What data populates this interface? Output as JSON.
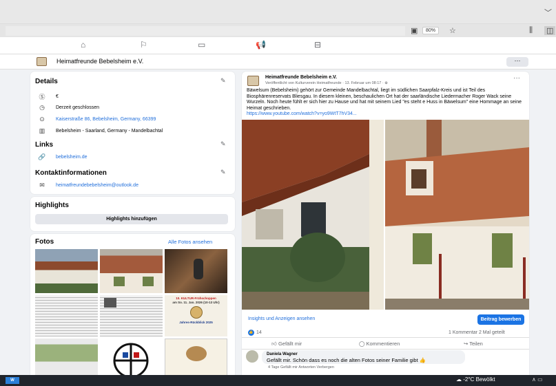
{
  "browser": {
    "zoom": "80%",
    "icons": [
      "chevron-down-icon",
      "screen-icon",
      "star-icon",
      "library-icon",
      "sidebar-icon"
    ]
  },
  "fb_nav": {
    "icons": [
      "home-icon",
      "flag-icon",
      "video-icon",
      "megaphone-icon",
      "gaming-icon"
    ]
  },
  "page": {
    "name": "Heimatfreunde Bebelsheim e.V.",
    "more": "···"
  },
  "details": {
    "title": "Details",
    "rows": [
      {
        "icon": "price-icon",
        "text": "€"
      },
      {
        "icon": "clock-icon",
        "text": "Derzeit geschlossen"
      },
      {
        "icon": "location-icon",
        "text": "Kaiserstraße 86, Bebelsheim, Germany, 66399"
      },
      {
        "icon": "map-icon",
        "text": "Bebelsheim - Saarland, Germany - Mandelbachtal"
      }
    ],
    "links_title": "Links",
    "link": "bebelsheim.de",
    "contact_title": "Kontaktinformationen",
    "email": "heimatfreundebebelsheim@outlook.de"
  },
  "highlights": {
    "title": "Highlights",
    "button": "Highlights hinzufügen"
  },
  "fotos": {
    "title": "Fotos",
    "all_link": "Alle Fotos ansehen",
    "poster_line1": "10. KULTUR-Frühschoppen",
    "poster_line2": "am So. 11. Jan. 2026 (10-13 Uhr)",
    "poster_line3": "Jahres-Rückblick 2025"
  },
  "post": {
    "author": "Heimatfreunde Bebelsheim e.V.",
    "meta": "Veröffentlicht von Kulturverein Heimatfreunde · 13. Februar um 08:17 · ",
    "text": "Bäwelsum (Bebelsheim) gehört zur Gemeinde Mandelbachtal, liegt im südlichen Saarpfalz-Kreis und ist Teil des Biosphärenreservats Bliesgau. In diesem kleinen,  beschaulichen Ort hat der saarländische Liedermacher Roger Wack seine Wurzeln. Noch heute fühlt er sich hier zu Hause und hat mit seinem Lied \"es steht e Huss in Bäwelsum\" eine Hommage an seine Heimat geschrieben.",
    "url": "https://www.youtube.com/watch?v=yo9WtT7hV34...",
    "insights": "Insights und Anzeigen ansehen",
    "promote": "Beitrag bewerben",
    "reactions": "14",
    "comments_shares": "1 Kommentar   2 Mal geteilt",
    "like": "Gefällt mir",
    "comment": "Kommentieren",
    "share": "Teilen"
  },
  "comment": {
    "name": "Daniela Wagner",
    "text": "Gefällt mir. Schön dass es noch die alten Fotos seiner Familie gibt 👍",
    "meta": "4 Tage    Gefällt mir    Antworten    Verbergen"
  },
  "taskbar": {
    "temp": "-2°C",
    "weather": "Bewölkt"
  }
}
